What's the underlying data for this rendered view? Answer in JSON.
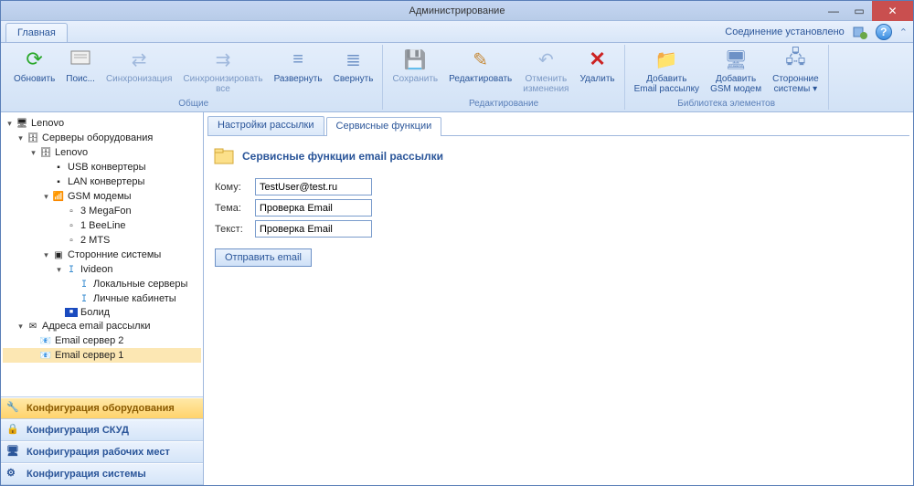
{
  "window": {
    "title": "Администрирование"
  },
  "ribbon": {
    "tab": "Главная",
    "connection_status": "Соединение установлено",
    "groups": {
      "common": {
        "label": "Общие",
        "refresh": "Обновить",
        "search": "Поис...",
        "sync": "Синхронизация",
        "sync_all": "Синхронизировать\nвсе",
        "expand": "Развернуть",
        "collapse": "Свернуть"
      },
      "edit": {
        "label": "Редактирование",
        "save": "Сохранить",
        "edit": "Редактировать",
        "undo": "Отменить\nизменения",
        "delete": "Удалить"
      },
      "library": {
        "label": "Библиотека элементов",
        "add_email": "Добавить\nEmail рассылку",
        "add_gsm": "Добавить\nGSM модем",
        "ext_systems": "Сторонние\nсистемы ▾"
      }
    }
  },
  "tree": {
    "root": "Lenovo",
    "hw_servers": "Серверы оборудования",
    "lenovo": "Lenovo",
    "usb": "USB конвертеры",
    "lan": "LAN конвертеры",
    "gsm": "GSM модемы",
    "mega": "3 MegaFon",
    "bee": "1 BeeLine",
    "mts": "2 MTS",
    "ext": "Сторонние системы",
    "ivideon": "Ivideon",
    "local_srv": "Локальные серверы",
    "cabinets": "Личные кабинеты",
    "bolid": "Болид",
    "email_addr": "Адреса email рассылки",
    "email2": "Email сервер 2",
    "email1": "Email сервер 1"
  },
  "nav": {
    "hw": "Конфигурация оборудования",
    "skud": "Конфигурация СКУД",
    "work": "Конфигурация рабочих мест",
    "sys": "Конфигурация системы"
  },
  "content": {
    "tab1": "Настройки рассылки",
    "tab2": "Сервисные функции",
    "section_title": "Сервисные функции email рассылки",
    "to_label": "Кому:",
    "to_value": "TestUser@test.ru",
    "subj_label": "Тема:",
    "subj_value": "Проверка Email",
    "text_label": "Текст:",
    "text_value": "Проверка Email",
    "send": "Отправить email"
  }
}
